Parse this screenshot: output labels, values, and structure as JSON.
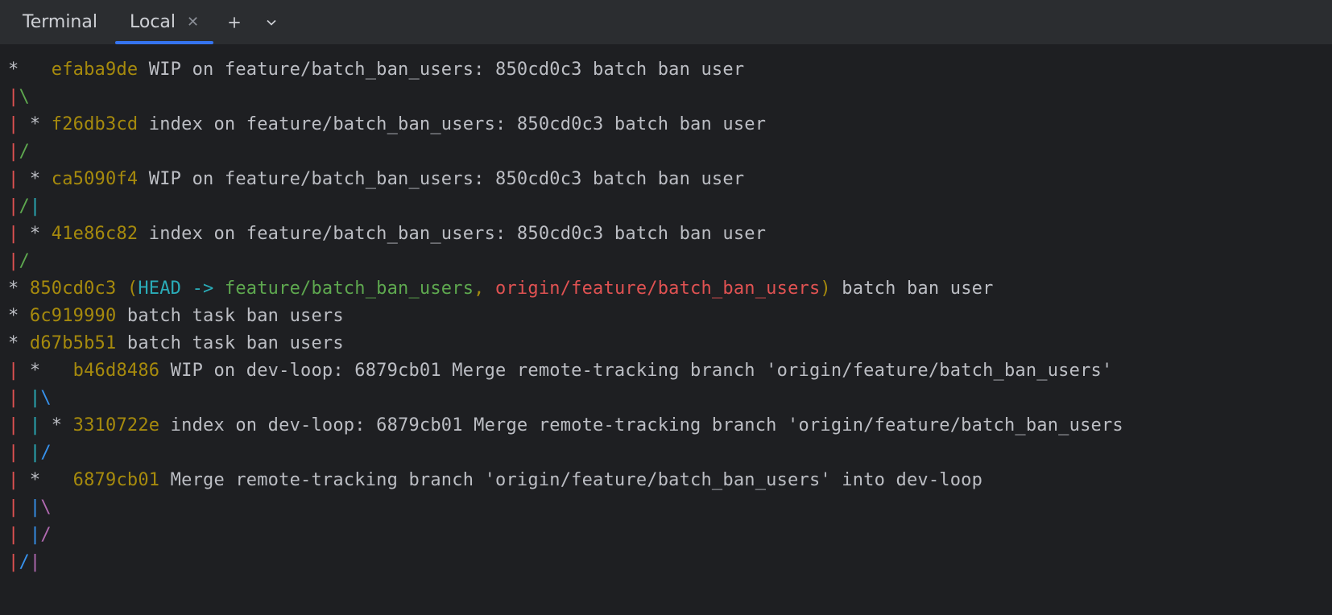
{
  "header": {
    "terminal_label": "Terminal",
    "tab_label": "Local"
  },
  "colors": {
    "accent": "#3574f0",
    "hash": "#a68a0d",
    "red": "#e05252",
    "green": "#5ea84f",
    "cyan": "#2aacb8",
    "blue": "#3792ed",
    "magenta": "#b169b1",
    "fg": "#bcbec4",
    "bg": "#1e1f22",
    "tabbar": "#2b2d30"
  },
  "icons": {
    "close": "close-icon",
    "plus": "plus-icon",
    "chevron_down": "chevron-down-icon"
  },
  "git_log": {
    "lines": [
      {
        "segments": [
          {
            "text": "*   ",
            "cls": "white"
          },
          {
            "text": "efaba9de",
            "cls": "hash"
          },
          {
            "text": " WIP on feature/batch_ban_users: 850cd0c3 batch ban user",
            "cls": "white"
          }
        ]
      },
      {
        "segments": [
          {
            "text": "|",
            "cls": "red"
          },
          {
            "text": "\\",
            "cls": "green"
          }
        ]
      },
      {
        "segments": [
          {
            "text": "| ",
            "cls": "red"
          },
          {
            "text": "* ",
            "cls": "white"
          },
          {
            "text": "f26db3cd",
            "cls": "hash"
          },
          {
            "text": " index on feature/batch_ban_users: 850cd0c3 batch ban user",
            "cls": "white"
          }
        ]
      },
      {
        "segments": [
          {
            "text": "|",
            "cls": "red"
          },
          {
            "text": "/",
            "cls": "green"
          }
        ]
      },
      {
        "segments": [
          {
            "text": "| ",
            "cls": "red"
          },
          {
            "text": "* ",
            "cls": "white"
          },
          {
            "text": "ca5090f4",
            "cls": "hash"
          },
          {
            "text": " WIP on feature/batch_ban_users: 850cd0c3 batch ban user",
            "cls": "white"
          }
        ]
      },
      {
        "segments": [
          {
            "text": "|",
            "cls": "red"
          },
          {
            "text": "/",
            "cls": "green"
          },
          {
            "text": "|",
            "cls": "cyan"
          }
        ]
      },
      {
        "segments": [
          {
            "text": "| ",
            "cls": "red"
          },
          {
            "text": "* ",
            "cls": "white"
          },
          {
            "text": "41e86c82",
            "cls": "hash"
          },
          {
            "text": " index on feature/batch_ban_users: 850cd0c3 batch ban user",
            "cls": "white"
          }
        ]
      },
      {
        "segments": [
          {
            "text": "|",
            "cls": "red"
          },
          {
            "text": "/",
            "cls": "green"
          }
        ]
      },
      {
        "segments": [
          {
            "text": "* ",
            "cls": "white"
          },
          {
            "text": "850cd0c3",
            "cls": "hash"
          },
          {
            "text": " (",
            "cls": "yellow"
          },
          {
            "text": "HEAD -> ",
            "cls": "cyan"
          },
          {
            "text": "feature/batch_ban_users",
            "cls": "green"
          },
          {
            "text": ", ",
            "cls": "yellow"
          },
          {
            "text": "origin/feature/batch_ban_users",
            "cls": "red"
          },
          {
            "text": ")",
            "cls": "yellow"
          },
          {
            "text": " batch ban user",
            "cls": "white"
          }
        ]
      },
      {
        "segments": [
          {
            "text": "* ",
            "cls": "white"
          },
          {
            "text": "6c919990",
            "cls": "hash"
          },
          {
            "text": " batch task ban users",
            "cls": "white"
          }
        ]
      },
      {
        "segments": [
          {
            "text": "* ",
            "cls": "white"
          },
          {
            "text": "d67b5b51",
            "cls": "hash"
          },
          {
            "text": " batch task ban users",
            "cls": "white"
          }
        ]
      },
      {
        "segments": [
          {
            "text": "| ",
            "cls": "red"
          },
          {
            "text": "*   ",
            "cls": "white"
          },
          {
            "text": "b46d8486",
            "cls": "hash"
          },
          {
            "text": " WIP on dev-loop: 6879cb01 Merge remote-tracking branch 'origin/feature/batch_ban_users'",
            "cls": "white"
          }
        ]
      },
      {
        "segments": [
          {
            "text": "| ",
            "cls": "red"
          },
          {
            "text": "|",
            "cls": "cyan"
          },
          {
            "text": "\\",
            "cls": "blue"
          }
        ]
      },
      {
        "segments": [
          {
            "text": "| ",
            "cls": "red"
          },
          {
            "text": "| ",
            "cls": "cyan"
          },
          {
            "text": "* ",
            "cls": "white"
          },
          {
            "text": "3310722e",
            "cls": "hash"
          },
          {
            "text": " index on dev-loop: 6879cb01 Merge remote-tracking branch 'origin/feature/batch_ban_users",
            "cls": "white"
          }
        ]
      },
      {
        "segments": [
          {
            "text": "| ",
            "cls": "red"
          },
          {
            "text": "|",
            "cls": "cyan"
          },
          {
            "text": "/",
            "cls": "blue"
          }
        ]
      },
      {
        "segments": [
          {
            "text": "| ",
            "cls": "red"
          },
          {
            "text": "*   ",
            "cls": "white"
          },
          {
            "text": "6879cb01",
            "cls": "hash"
          },
          {
            "text": " Merge remote-tracking branch 'origin/feature/batch_ban_users' into dev-loop",
            "cls": "white"
          }
        ]
      },
      {
        "segments": [
          {
            "text": "| ",
            "cls": "red"
          },
          {
            "text": "|",
            "cls": "blue"
          },
          {
            "text": "\\",
            "cls": "magenta"
          }
        ]
      },
      {
        "segments": [
          {
            "text": "| ",
            "cls": "red"
          },
          {
            "text": "|",
            "cls": "blue"
          },
          {
            "text": "/",
            "cls": "magenta"
          }
        ]
      },
      {
        "segments": [
          {
            "text": "|",
            "cls": "red"
          },
          {
            "text": "/",
            "cls": "blue"
          },
          {
            "text": "|",
            "cls": "magenta"
          }
        ]
      }
    ]
  }
}
